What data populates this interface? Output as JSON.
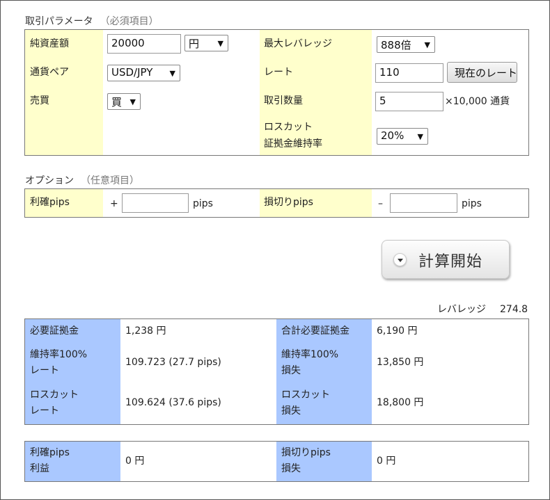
{
  "params": {
    "title": "取引パラメータ",
    "subtitle": "（必須項目）",
    "net_assets_label": "純資産額",
    "net_assets_value": "20000",
    "currency_unit": "円",
    "max_leverage_label": "最大レバレッジ",
    "max_leverage_value": "888倍",
    "pair_label": "通貨ペア",
    "pair_value": "USD/JPY",
    "rate_label": "レート",
    "rate_value": "110",
    "current_rate_button": "現在のレート",
    "side_label": "売買",
    "side_value": "買",
    "quantity_label": "取引数量",
    "quantity_value": "5",
    "quantity_unit": "×10,000 通貨",
    "losscut_label_1": "ロスカット",
    "losscut_label_2": "証拠金維持率",
    "losscut_value": "20%"
  },
  "options": {
    "title": "オプション",
    "subtitle": "（任意項目）",
    "tp_label": "利確pips",
    "tp_sign": "+",
    "tp_value": "",
    "tp_unit": "pips",
    "sl_label": "損切りpips",
    "sl_sign": "–",
    "sl_value": "",
    "sl_unit": "pips"
  },
  "calc_button": {
    "label": "計算開始",
    "icon": "chevron-down-icon"
  },
  "results": {
    "leverage_label": "レバレッジ",
    "leverage_value": "274.8",
    "required_margin_label": "必要証拠金",
    "required_margin_value": "1,238 円",
    "total_margin_label": "合計必要証拠金",
    "total_margin_value": "6,190 円",
    "maint100_rate_label_1": "維持率100%",
    "maint100_rate_label_2": "レート",
    "maint100_rate_value": "109.723 (27.7 pips)",
    "maint100_loss_label_1": "維持率100%",
    "maint100_loss_label_2": "損失",
    "maint100_loss_value": "13,850 円",
    "losscut_rate_label_1": "ロスカット",
    "losscut_rate_label_2": "レート",
    "losscut_rate_value": "109.624 (37.6 pips)",
    "losscut_loss_label_1": "ロスカット",
    "losscut_loss_label_2": "損失",
    "losscut_loss_value": "18,800 円"
  },
  "pnl": {
    "tp_label_1": "利確pips",
    "tp_label_2": "利益",
    "tp_value": "0 円",
    "sl_label_1": "損切りpips",
    "sl_label_2": "損失",
    "sl_value": "0 円"
  },
  "colors": {
    "param_label_bg": "#ffffcc",
    "result_label_bg": "#aac8ff"
  }
}
